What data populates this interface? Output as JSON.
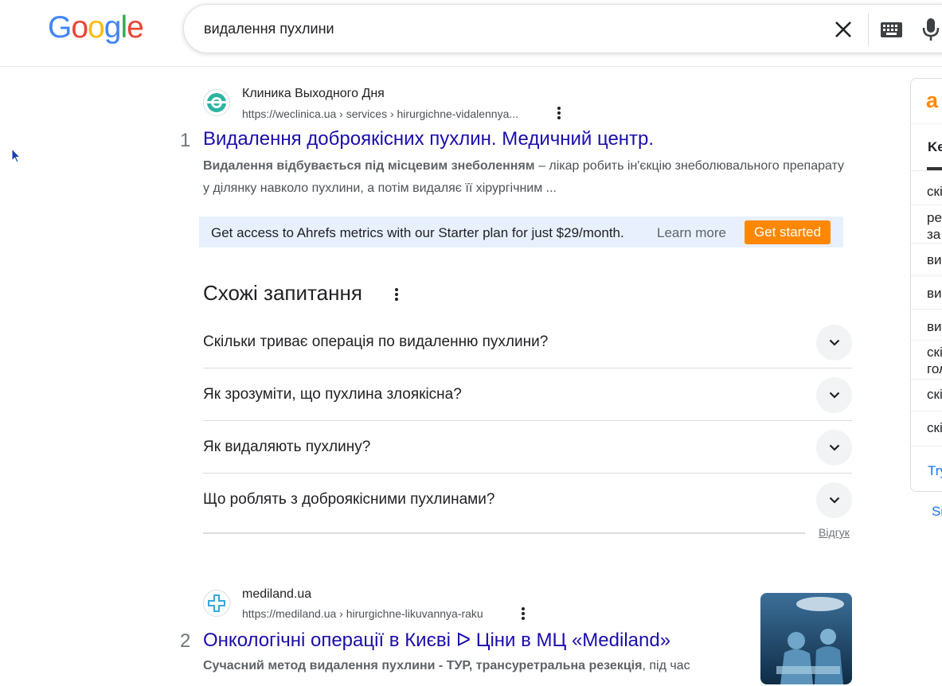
{
  "search": {
    "query": "видалення пухлини"
  },
  "logo": {
    "text": "Google"
  },
  "results": [
    {
      "rank": "1",
      "site_name": "Клиника Выходного Дня",
      "url": "https://weclinica.ua › services › hirurgichne-vidalennya...",
      "title": "Видалення доброякісних пухлин. Медичний центр.",
      "snippet_bold": "Видалення відбувається під місцевим знеболенням",
      "snippet_rest": " – лікар робить ін'єкцію знеболювального препарату у ділянку навколо пухлини, а потім видаляє її хірургічним ..."
    },
    {
      "rank": "2",
      "site_name": "mediland.ua",
      "url": "https://mediland.ua › hirurgichne-likuvannya-raku",
      "title": "Онкологічні операції в Києві ᐅ Ціни в МЦ «Mediland»",
      "snippet_bold": "Сучасний метод видалення пухлини - ТУР, трансуретральна резекція",
      "snippet_rest": ", під час"
    }
  ],
  "ahrefs": {
    "text": "Get access to Ahrefs metrics with our Starter plan for just $29/month.",
    "learn_more": "Learn more",
    "get_started": "Get started"
  },
  "paa": {
    "title": "Схожі запитання",
    "questions": [
      "Скільки триває операція по видаленню пухлини?",
      "Як зрозуміти, що пухлина злоякісна?",
      "Як видаляють пухлину?",
      "Що роблять з доброякісними пухлинами?"
    ],
    "feedback": "Відгук"
  },
  "panel": {
    "logo": "a",
    "heading": "Ke",
    "items": [
      "скі",
      "ре\nза",
      "ви",
      "ви",
      "ви",
      "скі\nгол",
      "скі",
      "скі"
    ],
    "link": "Try",
    "link2": "Si"
  },
  "colors": {
    "link": "#1a0dab",
    "accent": "#ff8800",
    "ahrefs_bg": "#e8f0fe"
  }
}
